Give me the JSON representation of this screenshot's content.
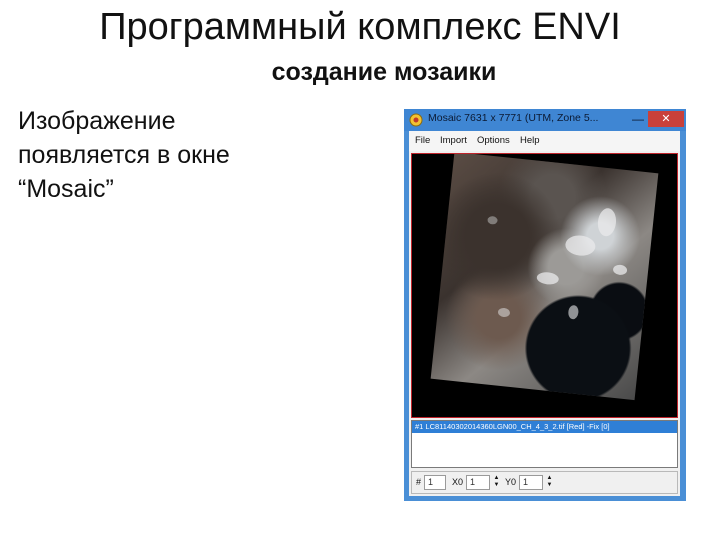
{
  "slide": {
    "title": "Программный комплекс ENVI",
    "subtitle": "создание мозаики",
    "body_lines": [
      "Изображение",
      "появляется в окне",
      "“Mosaic”"
    ]
  },
  "window": {
    "title": "Mosaic 7631 x 7771 (UTM, Zone 5...",
    "minimize_glyph": "—",
    "close_glyph": "✕",
    "menu": [
      "File",
      "Import",
      "Options",
      "Help"
    ],
    "layer_item": "#1 LC81140302014360LGN00_CH_4_3_2.tif [Red] -Fix [0]",
    "status": {
      "index_label": "#",
      "index_value": "1",
      "x0_label": "X0",
      "x0_value": "1",
      "y0_label": "Y0",
      "y0_value": "1"
    },
    "accent_color": "#3f86d3",
    "selection_color": "#2f7fd6",
    "border_color": "#c0242b"
  }
}
